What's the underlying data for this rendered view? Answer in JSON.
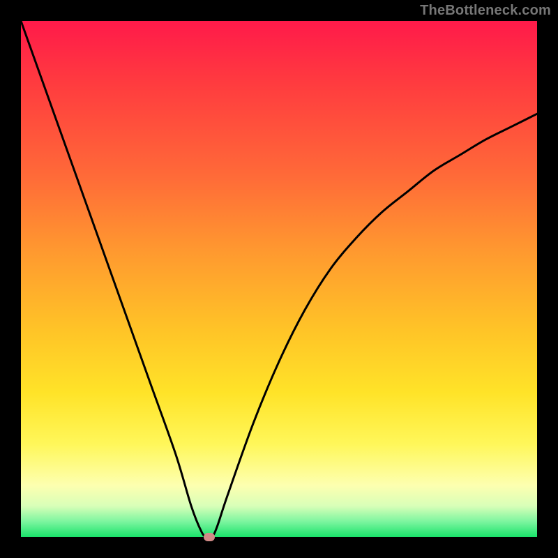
{
  "watermark": "TheBottleneck.com",
  "chart_data": {
    "type": "line",
    "title": "",
    "xlabel": "",
    "ylabel": "",
    "xlim": [
      0,
      100
    ],
    "ylim": [
      0,
      100
    ],
    "grid": false,
    "legend": false,
    "series": [
      {
        "name": "curve",
        "x": [
          0,
          5,
          10,
          15,
          20,
          25,
          30,
          33,
          35,
          36,
          37,
          38,
          40,
          45,
          50,
          55,
          60,
          65,
          70,
          75,
          80,
          85,
          90,
          95,
          100
        ],
        "y": [
          100,
          86,
          72,
          58,
          44,
          30,
          16,
          6,
          1,
          0,
          0,
          2,
          8,
          22,
          34,
          44,
          52,
          58,
          63,
          67,
          71,
          74,
          77,
          79.5,
          82
        ]
      }
    ],
    "marker": {
      "x": 36.5,
      "y": 0
    },
    "background_gradient": {
      "stops": [
        {
          "pos": 0,
          "color": "#ff1a4a"
        },
        {
          "pos": 12,
          "color": "#ff3b3f"
        },
        {
          "pos": 30,
          "color": "#ff6a38"
        },
        {
          "pos": 45,
          "color": "#ff9a2f"
        },
        {
          "pos": 60,
          "color": "#ffc427"
        },
        {
          "pos": 72,
          "color": "#ffe328"
        },
        {
          "pos": 82,
          "color": "#fff75a"
        },
        {
          "pos": 90,
          "color": "#fdffb0"
        },
        {
          "pos": 94,
          "color": "#d8ffb8"
        },
        {
          "pos": 97,
          "color": "#7cf59f"
        },
        {
          "pos": 100,
          "color": "#19e36a"
        }
      ]
    }
  }
}
